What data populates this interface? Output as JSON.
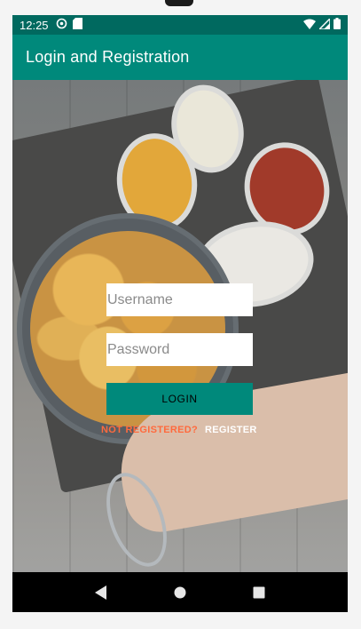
{
  "status_bar": {
    "time": "12:25",
    "left_icons": [
      "sync-icon",
      "sd-card-icon"
    ],
    "right_icons": [
      "wifi-icon",
      "signal-icon",
      "battery-icon"
    ]
  },
  "app_bar": {
    "title": "Login and Registration"
  },
  "form": {
    "username": {
      "value": "",
      "placeholder": "Username"
    },
    "password": {
      "value": "",
      "placeholder": "Password"
    },
    "login_label": "LOGIN"
  },
  "register": {
    "prompt": "NOT REGISTERED?",
    "link_label": "REGISTER"
  },
  "nav_bar": {
    "icons": [
      "back-icon",
      "home-icon",
      "recents-icon"
    ]
  },
  "colors": {
    "primary": "#00897b",
    "primary_dark": "#00695f",
    "accent_text": "#ff6a3d"
  }
}
